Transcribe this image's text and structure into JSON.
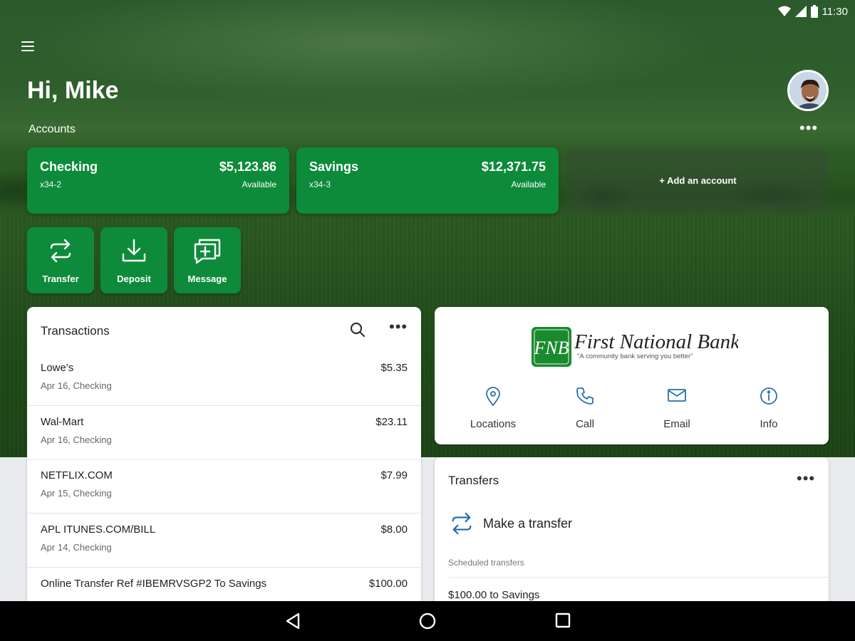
{
  "status_bar": {
    "time": "11:30"
  },
  "header": {
    "greeting": "Hi, Mike"
  },
  "accounts": {
    "label": "Accounts",
    "items": [
      {
        "name": "Checking",
        "number": "x34-2",
        "balance": "$5,123.86",
        "balance_label": "Available"
      },
      {
        "name": "Savings",
        "number": "x34-3",
        "balance": "$12,371.75",
        "balance_label": "Available"
      }
    ],
    "add_label": "+ Add an account"
  },
  "actions": [
    {
      "label": "Transfer",
      "icon": "transfer-icon"
    },
    {
      "label": "Deposit",
      "icon": "deposit-icon"
    },
    {
      "label": "Message",
      "icon": "message-icon"
    }
  ],
  "transactions": {
    "title": "Transactions",
    "items": [
      {
        "merchant": "Lowe's",
        "detail": "Apr 16, Checking",
        "amount": "$5.35"
      },
      {
        "merchant": "Wal-Mart",
        "detail": "Apr 16, Checking",
        "amount": "$23.11"
      },
      {
        "merchant": "NETFLIX.COM",
        "detail": "Apr 15, Checking",
        "amount": "$7.99"
      },
      {
        "merchant": "APL ITUNES.COM/BILL",
        "detail": "Apr 14, Checking",
        "amount": "$8.00"
      },
      {
        "merchant": "Online Transfer Ref #IBEMRVSGP2 To Savings",
        "detail": "",
        "amount": "$100.00"
      }
    ]
  },
  "bank": {
    "logo_mark": "FNB",
    "name": "First National Bank",
    "tagline": "\"A community bank serving you better\"",
    "quick_links": [
      {
        "label": "Locations",
        "icon": "location-pin-icon"
      },
      {
        "label": "Call",
        "icon": "phone-icon"
      },
      {
        "label": "Email",
        "icon": "email-icon"
      },
      {
        "label": "Info",
        "icon": "info-icon"
      }
    ]
  },
  "transfers": {
    "title": "Transfers",
    "make_label": "Make a transfer",
    "scheduled_label": "Scheduled transfers",
    "scheduled": [
      {
        "text": "$100.00 to Savings"
      }
    ]
  },
  "colors": {
    "brand_green": "#0d8b3a",
    "accent_blue": "#2a6fb0",
    "nav_black": "#000000"
  }
}
